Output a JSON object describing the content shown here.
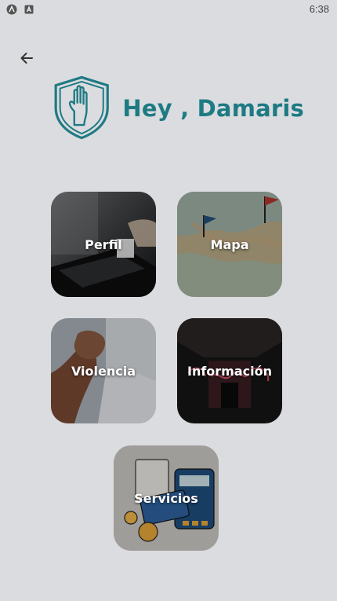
{
  "status_bar": {
    "time": "6:38",
    "icons": [
      "android-icon",
      "app-notification-icon"
    ]
  },
  "header": {
    "greeting": "Hey , Damaris",
    "logo": "shield-hand-icon",
    "brand_color": "#1e7a83"
  },
  "menu": {
    "perfil": "Perfil",
    "mapa": "Mapa",
    "violencia": "Violencia",
    "informacion": "Información",
    "servicios": "Servicios"
  }
}
